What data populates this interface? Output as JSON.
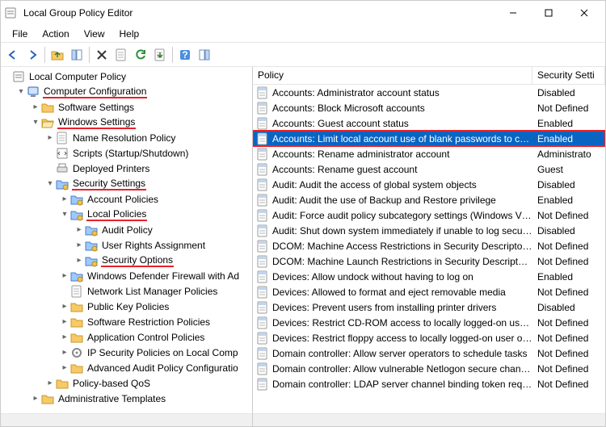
{
  "window": {
    "title": "Local Group Policy Editor"
  },
  "menu": {
    "file": "File",
    "action": "Action",
    "view": "View",
    "help": "Help"
  },
  "toolbar_icons": [
    "back",
    "forward",
    "up",
    "show-hide-tree",
    "delete",
    "properties",
    "refresh",
    "export-list",
    "help",
    "show-hide-action-pane"
  ],
  "list": {
    "header": {
      "name": "Policy",
      "value": "Security Setti"
    },
    "rows": [
      {
        "name": "Accounts: Administrator account status",
        "value": "Disabled",
        "sel": false
      },
      {
        "name": "Accounts: Block Microsoft accounts",
        "value": "Not Defined",
        "sel": false
      },
      {
        "name": "Accounts: Guest account status",
        "value": "Enabled",
        "sel": false
      },
      {
        "name": "Accounts: Limit local account use of blank passwords to co...",
        "value": "Enabled",
        "sel": true
      },
      {
        "name": "Accounts: Rename administrator account",
        "value": "Administrato",
        "sel": false
      },
      {
        "name": "Accounts: Rename guest account",
        "value": "Guest",
        "sel": false
      },
      {
        "name": "Audit: Audit the access of global system objects",
        "value": "Disabled",
        "sel": false
      },
      {
        "name": "Audit: Audit the use of Backup and Restore privilege",
        "value": "Enabled",
        "sel": false
      },
      {
        "name": "Audit: Force audit policy subcategory settings (Windows Vis...",
        "value": "Not Defined",
        "sel": false
      },
      {
        "name": "Audit: Shut down system immediately if unable to log secur...",
        "value": "Disabled",
        "sel": false
      },
      {
        "name": "DCOM: Machine Access Restrictions in Security Descriptor D...",
        "value": "Not Defined",
        "sel": false
      },
      {
        "name": "DCOM: Machine Launch Restrictions in Security Descriptor ...",
        "value": "Not Defined",
        "sel": false
      },
      {
        "name": "Devices: Allow undock without having to log on",
        "value": "Enabled",
        "sel": false
      },
      {
        "name": "Devices: Allowed to format and eject removable media",
        "value": "Not Defined",
        "sel": false
      },
      {
        "name": "Devices: Prevent users from installing printer drivers",
        "value": "Disabled",
        "sel": false
      },
      {
        "name": "Devices: Restrict CD-ROM access to locally logged-on user ...",
        "value": "Not Defined",
        "sel": false
      },
      {
        "name": "Devices: Restrict floppy access to locally logged-on user only",
        "value": "Not Defined",
        "sel": false
      },
      {
        "name": "Domain controller: Allow server operators to schedule tasks",
        "value": "Not Defined",
        "sel": false
      },
      {
        "name": "Domain controller: Allow vulnerable Netlogon secure chann...",
        "value": "Not Defined",
        "sel": false
      },
      {
        "name": "Domain controller: LDAP server channel binding token requi...",
        "value": "Not Defined",
        "sel": false
      }
    ]
  },
  "tree": {
    "root": {
      "label": "Local Computer Policy",
      "icon": "policy-root",
      "tw": ""
    },
    "cc": {
      "label": "Computer Configuration",
      "icon": "computer",
      "tw": "v",
      "hl": true
    },
    "sw": {
      "label": "Software Settings",
      "icon": "folder",
      "tw": ">"
    },
    "ws": {
      "label": "Windows Settings",
      "icon": "folder-open",
      "tw": "v",
      "hl": true
    },
    "nrp": {
      "label": "Name Resolution Policy",
      "icon": "page",
      "tw": ">"
    },
    "scripts": {
      "label": "Scripts (Startup/Shutdown)",
      "icon": "script",
      "tw": ""
    },
    "dprn": {
      "label": "Deployed Printers",
      "icon": "printer",
      "tw": ""
    },
    "sec": {
      "label": "Security Settings",
      "icon": "blue-folder",
      "tw": "v",
      "hl": true
    },
    "acct": {
      "label": "Account Policies",
      "icon": "blue-folder",
      "tw": ">"
    },
    "local": {
      "label": "Local Policies",
      "icon": "blue-folder",
      "tw": "v",
      "hl": true
    },
    "audit": {
      "label": "Audit Policy",
      "icon": "blue-folder",
      "tw": ">"
    },
    "ura": {
      "label": "User Rights Assignment",
      "icon": "blue-folder",
      "tw": ">"
    },
    "secopt": {
      "label": "Security Options",
      "icon": "blue-folder",
      "tw": ">",
      "hl": true
    },
    "wdf": {
      "label": "Windows Defender Firewall with Ad",
      "icon": "blue-folder",
      "tw": ">"
    },
    "nlm": {
      "label": "Network List Manager Policies",
      "icon": "page",
      "tw": ""
    },
    "pkp": {
      "label": "Public Key Policies",
      "icon": "folder",
      "tw": ">"
    },
    "srp": {
      "label": "Software Restriction Policies",
      "icon": "folder",
      "tw": ">"
    },
    "acp": {
      "label": "Application Control Policies",
      "icon": "folder",
      "tw": ">"
    },
    "ipsec": {
      "label": "IP Security Policies on Local Comp",
      "icon": "gear",
      "tw": ">"
    },
    "aap": {
      "label": "Advanced Audit Policy Configuratio",
      "icon": "folder",
      "tw": ">"
    },
    "qos": {
      "label": "Policy-based QoS",
      "icon": "folder",
      "tw": ">"
    },
    "adm": {
      "label": "Administrative Templates",
      "icon": "folder",
      "tw": ">"
    }
  }
}
